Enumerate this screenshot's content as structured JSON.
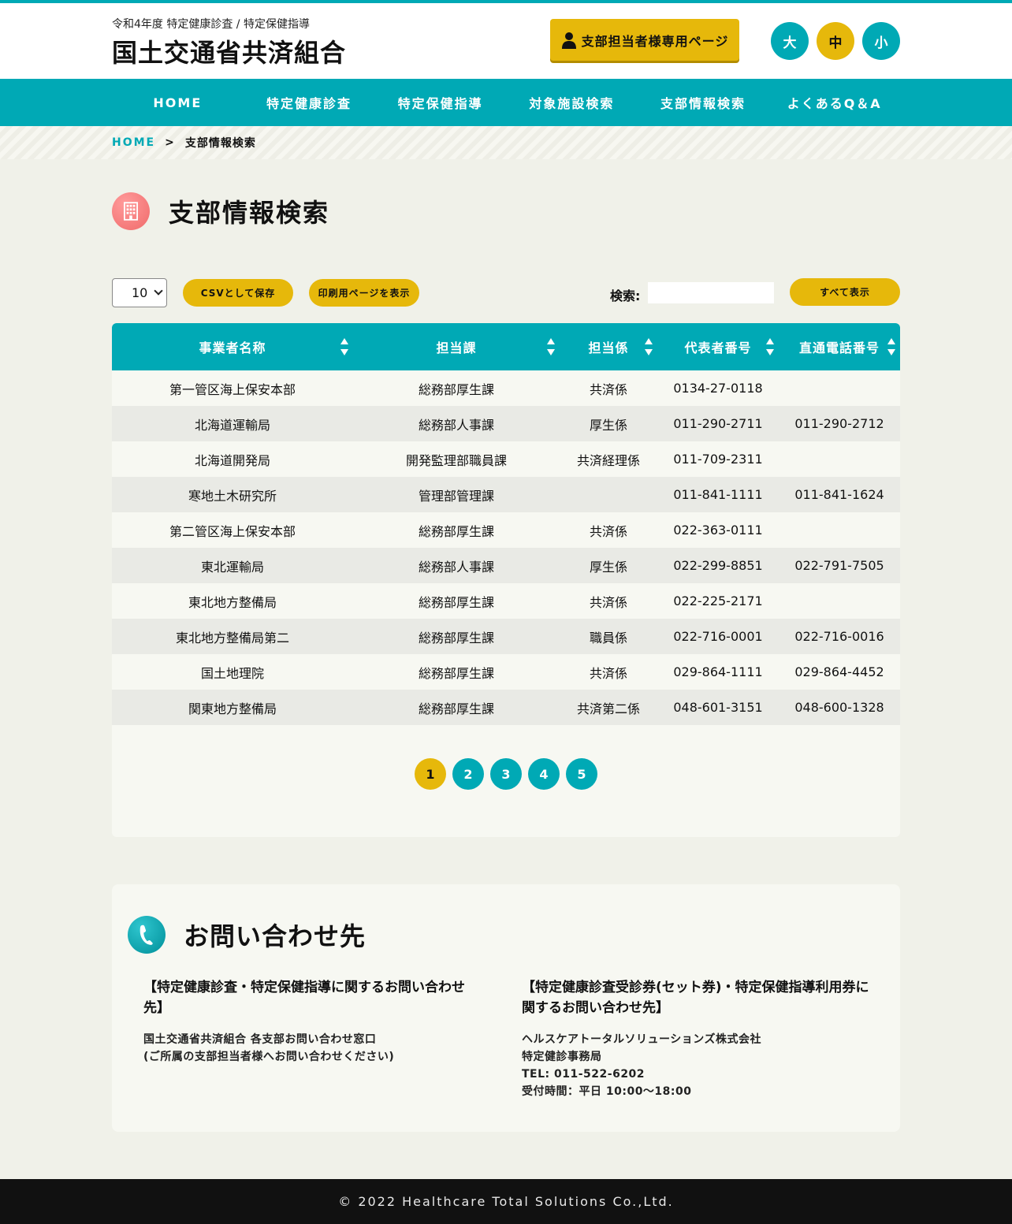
{
  "header": {
    "subtitle": "令和4年度 特定健康診査 / 特定保健指導",
    "title": "国土交通省共済組合",
    "staff_button": "支部担当者様専用ページ",
    "font_sizes": [
      "大",
      "中",
      "小"
    ]
  },
  "nav": {
    "items": [
      "HOME",
      "特定健康診査",
      "特定保健指導",
      "対象施設検索",
      "支部情報検索",
      "よくあるQ＆A"
    ]
  },
  "breadcrumb": {
    "home": "HOME",
    "separator": ">",
    "current": "支部情報検索"
  },
  "page": {
    "title": "支部情報検索"
  },
  "controls": {
    "page_length": "10",
    "csv_button": "CSVとして保存",
    "print_button": "印刷用ページを表示",
    "search_label": "検索:",
    "search_value": "",
    "show_all_button": "すべて表示"
  },
  "table": {
    "columns": [
      "事業者名称",
      "担当課",
      "担当係",
      "代表者番号",
      "直通電話番号"
    ],
    "rows": [
      [
        "第一管区海上保安本部",
        "総務部厚生課",
        "共済係",
        "0134-27-0118",
        ""
      ],
      [
        "北海道運輸局",
        "総務部人事課",
        "厚生係",
        "011-290-2711",
        "011-290-2712"
      ],
      [
        "北海道開発局",
        "開発監理部職員課",
        "共済経理係",
        "011-709-2311",
        ""
      ],
      [
        "寒地土木研究所",
        "管理部管理課",
        "",
        "011-841-1111",
        "011-841-1624"
      ],
      [
        "第二管区海上保安本部",
        "総務部厚生課",
        "共済係",
        "022-363-0111",
        ""
      ],
      [
        "東北運輸局",
        "総務部人事課",
        "厚生係",
        "022-299-8851",
        "022-791-7505"
      ],
      [
        "東北地方整備局",
        "総務部厚生課",
        "共済係",
        "022-225-2171",
        ""
      ],
      [
        "東北地方整備局第二",
        "総務部厚生課",
        "職員係",
        "022-716-0001",
        "022-716-0016"
      ],
      [
        "国土地理院",
        "総務部厚生課",
        "共済係",
        "029-864-1111",
        "029-864-4452"
      ],
      [
        "関東地方整備局",
        "総務部厚生課",
        "共済第二係",
        "048-601-3151",
        "048-600-1328"
      ]
    ]
  },
  "pagination": {
    "pages": [
      "1",
      "2",
      "3",
      "4",
      "5"
    ],
    "current": "1"
  },
  "contact": {
    "title": "お問い合わせ先",
    "left": {
      "heading": "【特定健康診査・特定保健指導に関するお問い合わせ先】",
      "line1": "国土交通省共済組合 各支部お問い合わせ窓口",
      "line2": "(ご所属の支部担当者様へお問い合わせください)"
    },
    "right": {
      "heading": "【特定健康診査受診券(セット券)・特定保健指導利用券に関するお問い合わせ先】",
      "line1": "ヘルスケアトータルソリューションズ株式会社",
      "line2": "特定健診事務局",
      "line3": "TEL: 011-522-6202",
      "line4": "受付時間：平日 10:00～18:00"
    }
  },
  "footer": {
    "copyright": "© 2022 Healthcare Total Solutions Co.,Ltd."
  },
  "colors": {
    "teal": "#00a9b5",
    "gold": "#e6b80b",
    "background": "#f0f1e9",
    "footer": "#111111"
  },
  "icons": {
    "staff": "person-icon",
    "page": "building-icon",
    "contact": "phone-icon"
  }
}
